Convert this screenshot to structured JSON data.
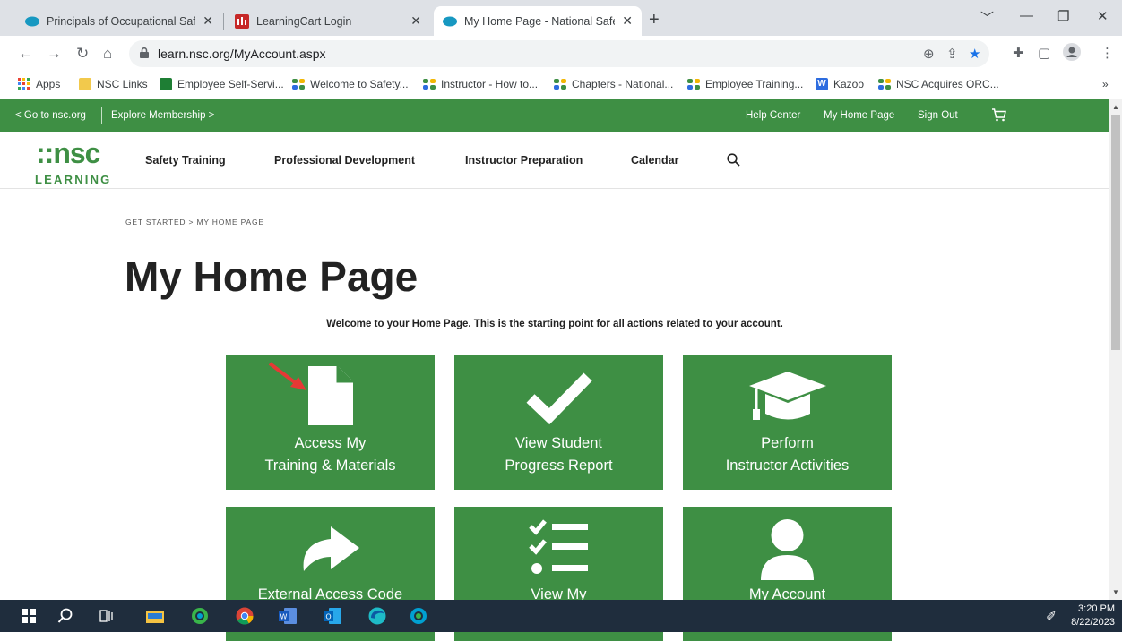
{
  "browser": {
    "tabs": [
      {
        "title": "Principals of Occupational Safety"
      },
      {
        "title": "LearningCart Login"
      },
      {
        "title": "My Home Page - National Safety"
      }
    ],
    "url": "learn.nsc.org/MyAccount.aspx",
    "bookmarks": [
      {
        "label": "Apps"
      },
      {
        "label": "NSC Links"
      },
      {
        "label": "Employee Self-Servi..."
      },
      {
        "label": "Welcome to Safety..."
      },
      {
        "label": "Instructor - How to..."
      },
      {
        "label": "Chapters - National..."
      },
      {
        "label": "Employee Training..."
      },
      {
        "label": "Kazoo"
      },
      {
        "label": "NSC Acquires ORC..."
      }
    ],
    "more_bookmarks": "»"
  },
  "topbar": {
    "go_to_nsc": "< Go to nsc.org",
    "explore_membership": "Explore Membership >",
    "help_center": "Help Center",
    "my_home_page": "My Home Page",
    "sign_out": "Sign Out"
  },
  "site": {
    "logo_top": "::nsc",
    "logo_bottom": "LEARNING",
    "nav": [
      "Safety Training",
      "Professional Development",
      "Instructor Preparation",
      "Calendar"
    ]
  },
  "page": {
    "breadcrumb": "GET STARTED > MY HOME PAGE",
    "title": "My Home Page",
    "welcome": "Welcome to your Home Page. This is the starting point for all actions related to your account.",
    "tiles": [
      {
        "line1": "Access My",
        "line2": "Training & Materials",
        "icon": "document-icon"
      },
      {
        "line1": "View Student",
        "line2": "Progress Report",
        "icon": "checkmark-icon"
      },
      {
        "line1": "Perform",
        "line2": "Instructor Activities",
        "icon": "graduation-cap-icon"
      },
      {
        "line1": "External Access Code",
        "line2": "",
        "icon": "share-arrow-icon"
      },
      {
        "line1": "View My",
        "line2": "",
        "icon": "checklist-icon"
      },
      {
        "line1": "My Account",
        "line2": "",
        "icon": "user-icon"
      }
    ]
  },
  "taskbar": {
    "time": "3:20 PM",
    "date": "8/22/2023"
  },
  "colors": {
    "nsc_green": "#3e8f44",
    "taskbar": "#1f2d3d",
    "annotation_arrow": "#e53935"
  }
}
